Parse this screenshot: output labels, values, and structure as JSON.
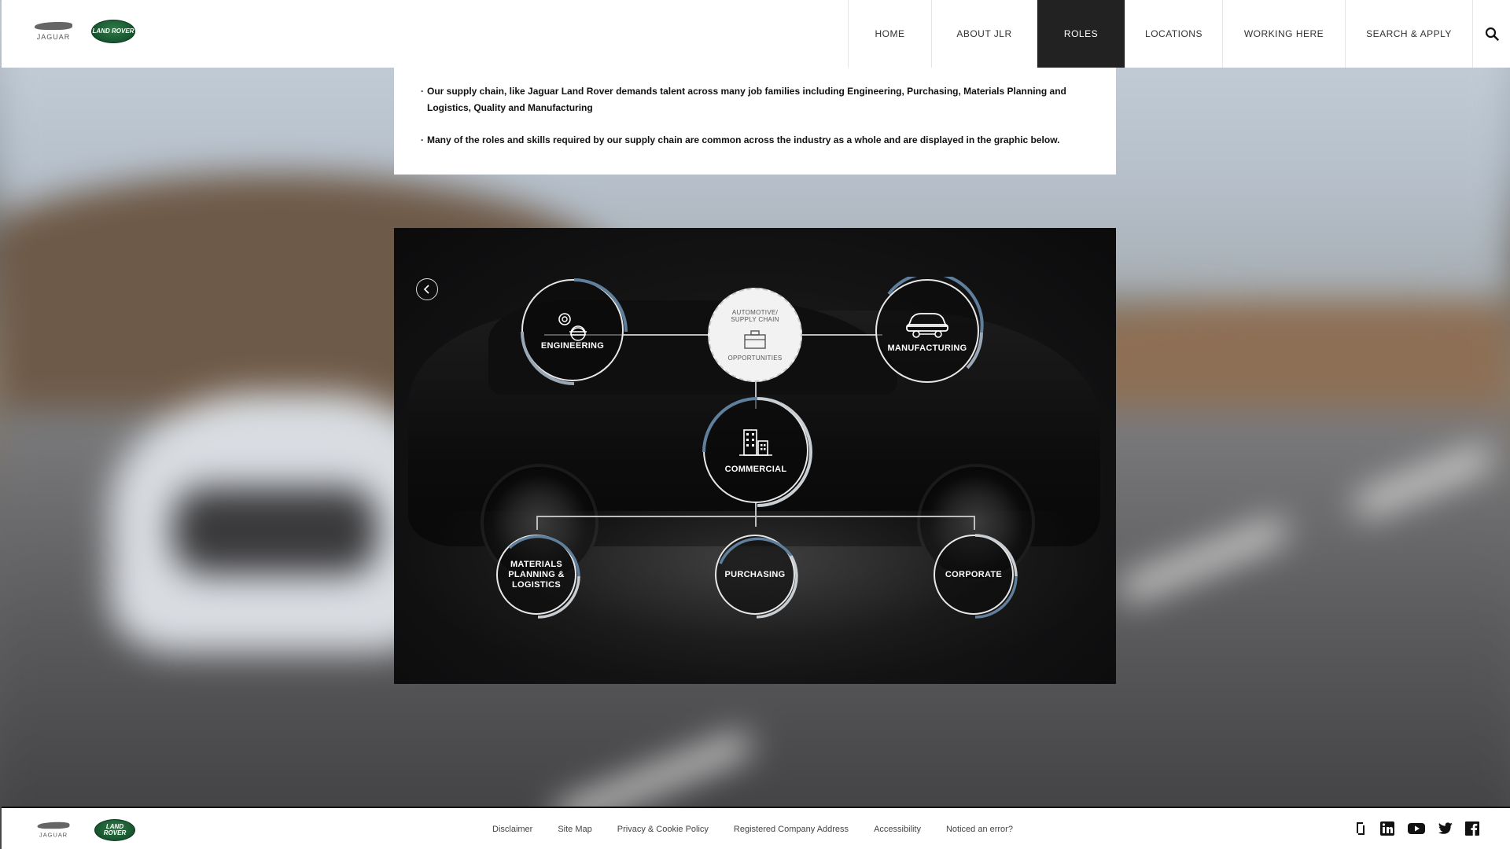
{
  "header": {
    "logos": {
      "jaguar_text": "JAGUAR",
      "land_rover_text": "LAND ROVER"
    },
    "nav": [
      {
        "label": "HOME",
        "active": false
      },
      {
        "label": "ABOUT JLR",
        "active": false
      },
      {
        "label": "ROLES",
        "active": true
      },
      {
        "label": "LOCATIONS",
        "active": false
      },
      {
        "label": "WORKING HERE",
        "active": false
      },
      {
        "label": "SEARCH & APPLY",
        "active": false
      }
    ],
    "search_icon": "search-icon"
  },
  "intro": {
    "bullets": [
      "Our supply chain, like Jaguar Land Rover demands talent across many job families including Engineering, Purchasing, Materials Planning and Logistics, Quality and Manufacturing",
      "Many of the roles and skills required by our supply chain are common across the industry as a whole and are displayed in the graphic below."
    ]
  },
  "graphic": {
    "back_icon": "chevron-left-icon",
    "center": {
      "top_label": "AUTOMOTIVE/ SUPPLY CHAIN",
      "bottom_label": "OPPORTUNITIES",
      "icon": "briefcase-icon"
    },
    "nodes": {
      "engineering": {
        "label": "ENGINEERING",
        "icon": "gear-hardhat-icon"
      },
      "manufacturing": {
        "label": "MANUFACTURING",
        "icon": "car-icon"
      },
      "commercial": {
        "label": "COMMERCIAL",
        "icon": "buildings-icon"
      },
      "materials": {
        "label": "MATERIALS PLANNING & LOGISTICS"
      },
      "purchasing": {
        "label": "PURCHASING"
      },
      "corporate": {
        "label": "CORPORATE"
      }
    },
    "accent_color": "#5f7f9c"
  },
  "footer": {
    "links": [
      "Disclaimer",
      "Site Map",
      "Privacy & Cookie Policy",
      "Registered Company Address",
      "Accessibility",
      "Noticed an error?"
    ],
    "social": [
      "glassdoor-icon",
      "linkedin-icon",
      "youtube-icon",
      "twitter-icon",
      "facebook-icon"
    ]
  }
}
